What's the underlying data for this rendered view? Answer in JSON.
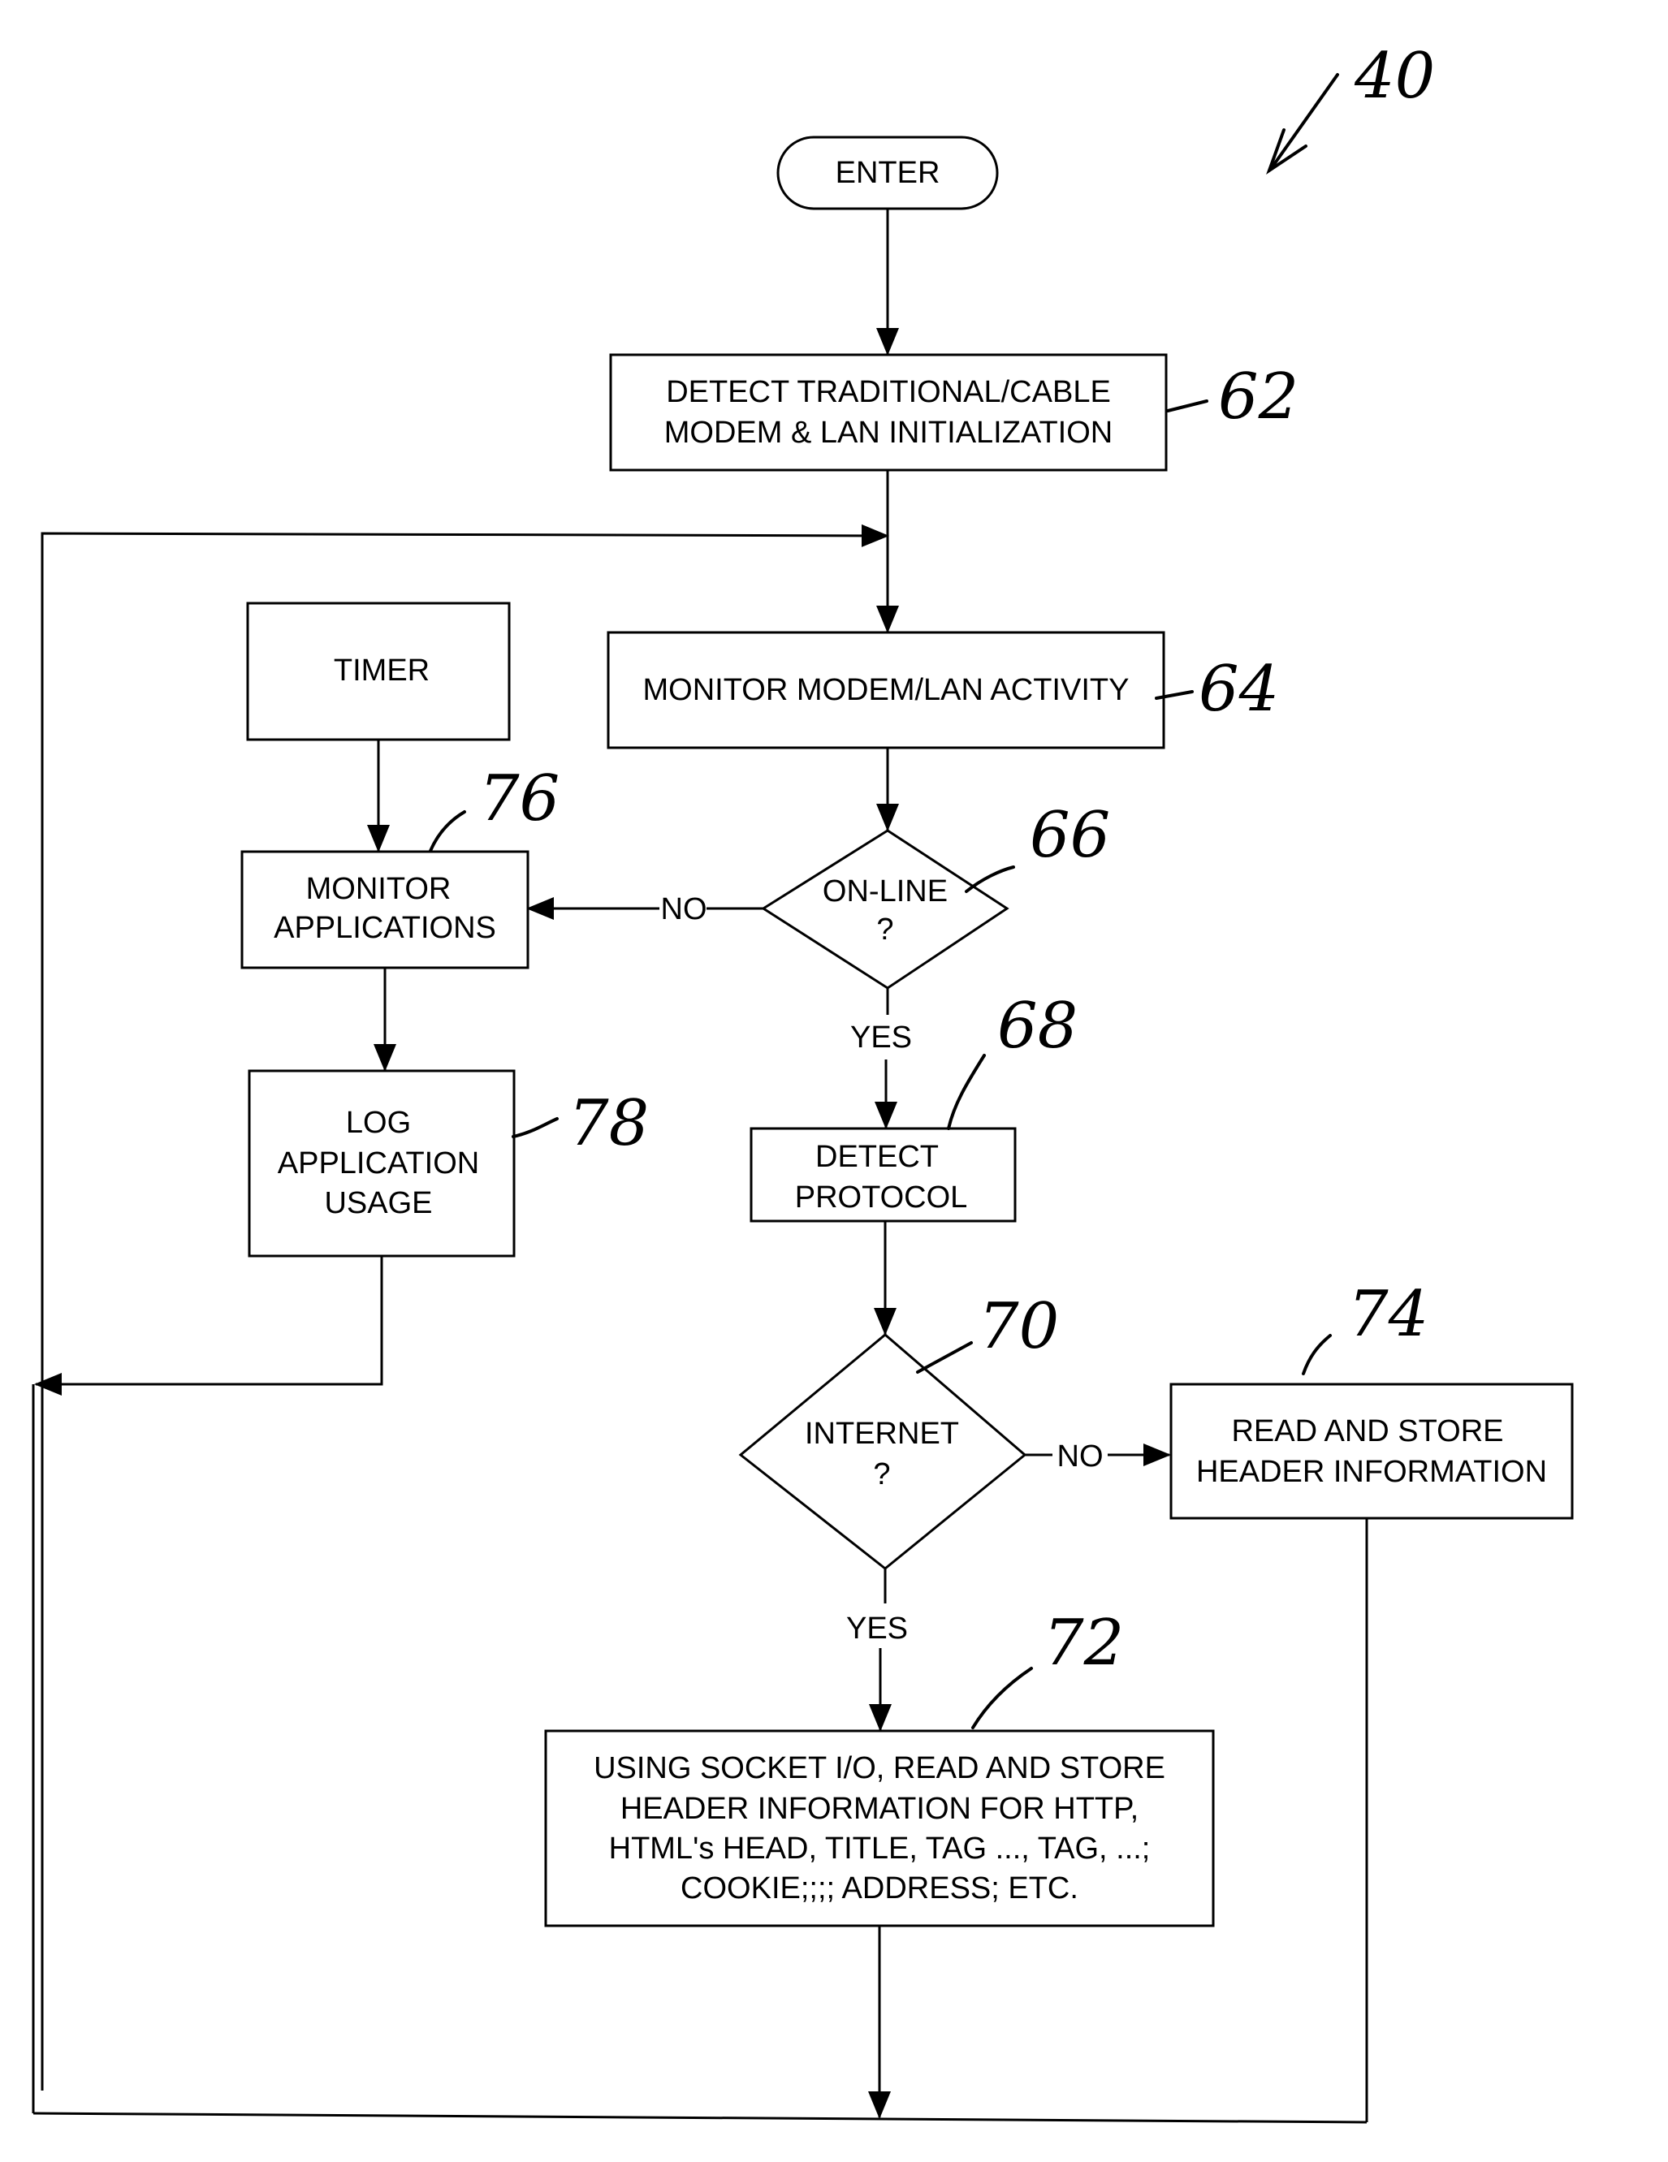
{
  "figure": {
    "reference": "40",
    "nodes": {
      "enter": {
        "id": "",
        "lines": [
          "ENTER"
        ]
      },
      "detect_init": {
        "id": "62",
        "lines": [
          "DETECT TRADITIONAL/CABLE",
          "MODEM & LAN INITIALIZATION"
        ]
      },
      "monitor_activity": {
        "id": "64",
        "lines": [
          "MONITOR MODEM/LAN ACTIVITY"
        ]
      },
      "online": {
        "id": "66",
        "lines": [
          "ON-LINE",
          "?"
        ]
      },
      "detect_protocol": {
        "id": "68",
        "lines": [
          "DETECT",
          "PROTOCOL"
        ]
      },
      "internet": {
        "id": "70",
        "lines": [
          "INTERNET",
          "?"
        ]
      },
      "socket_io": {
        "id": "72",
        "lines": [
          "USING SOCKET I/O, READ AND STORE",
          "HEADER INFORMATION FOR HTTP,",
          "HTML's HEAD, TITLE, TAG ..., TAG, ...;",
          "COOKIE;;;; ADDRESS; ETC."
        ]
      },
      "read_store": {
        "id": "74",
        "lines": [
          "READ AND STORE",
          "HEADER INFORMATION"
        ]
      },
      "timer": {
        "id": "",
        "lines": [
          "TIMER"
        ]
      },
      "monitor_apps": {
        "id": "76",
        "lines": [
          "MONITOR",
          "APPLICATIONS"
        ]
      },
      "log_usage": {
        "id": "78",
        "lines": [
          "LOG",
          "APPLICATION",
          "USAGE"
        ]
      }
    },
    "edge_labels": {
      "online_no": "NO",
      "online_yes": "YES",
      "internet_no": "NO",
      "internet_yes": "YES"
    }
  }
}
